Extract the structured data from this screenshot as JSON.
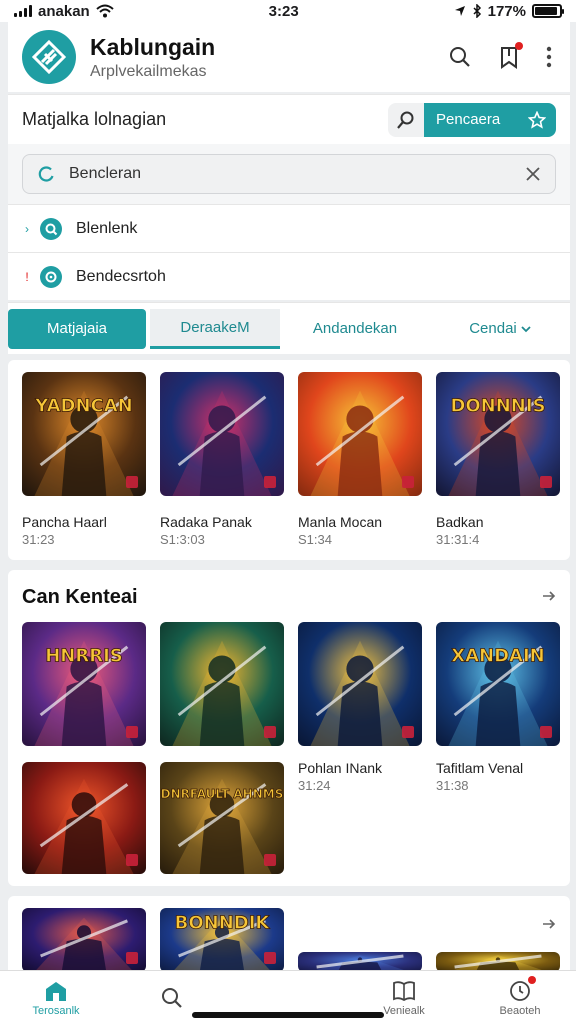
{
  "status": {
    "carrier": "anakan",
    "time": "3:23",
    "battery": "177%",
    "battery_level": 0.92
  },
  "header": {
    "title": "Kablungain",
    "subtitle": "Arplvekailmekas"
  },
  "search_row": {
    "heading": "Matjalka lolnagian",
    "button_label": "Pencaera"
  },
  "filter": {
    "value": "Bencleran"
  },
  "suggestions": [
    {
      "label": "Blenlenk",
      "marker": "›",
      "marker_color": "#1f9ea3"
    },
    {
      "label": "Bendecsrtoh",
      "marker": "!",
      "marker_color": "#e02020"
    }
  ],
  "tabs": [
    "Matjajaia",
    "DeraakeM",
    "Andandekan",
    "Cendai"
  ],
  "featured": {
    "items": [
      {
        "label": "Pancha Haarl",
        "time": "31:23",
        "art": "YADNCAN",
        "colors": [
          "#5a3312",
          "#e08a2a",
          "#22170d"
        ]
      },
      {
        "label": "Radaka Panak",
        "time": "S1:3:03",
        "art": "",
        "colors": [
          "#1b2d72",
          "#d03068",
          "#2f1a4c"
        ]
      },
      {
        "label": "Manla Mocan",
        "time": "S1:34",
        "art": "",
        "colors": [
          "#e0461c",
          "#f7c337",
          "#8a2c10"
        ]
      },
      {
        "label": "Badkan",
        "time": "31:31:4",
        "art": "DONNNIS",
        "colors": [
          "#2a3c86",
          "#e04820",
          "#151838"
        ]
      }
    ]
  },
  "section": {
    "title": "Can Kenteai",
    "items": [
      {
        "label": "",
        "time": "",
        "art": "HNRRIS",
        "colors": [
          "#5b2a86",
          "#ef5a7a",
          "#2b1442"
        ]
      },
      {
        "label": "",
        "time": "",
        "art": "",
        "colors": [
          "#165e4a",
          "#f2b630",
          "#0f2a22"
        ]
      },
      {
        "label": "Pohlan INank",
        "time": "31:24",
        "art": "",
        "colors": [
          "#0f2f6a",
          "#f3c240",
          "#0a1838"
        ]
      },
      {
        "label": "Tafitlam Venal",
        "time": "31:38",
        "art": "XANDAIN",
        "colors": [
          "#143c7a",
          "#5fc3e8",
          "#0b1b3e"
        ]
      },
      {
        "label": "",
        "time": "",
        "art": "",
        "colors": [
          "#8a1a14",
          "#f0562a",
          "#2c0c0a"
        ]
      },
      {
        "label": "",
        "time": "",
        "art": "DNRFAULT AHNMS",
        "colors": [
          "#5a4418",
          "#e0a63a",
          "#2a1e0c"
        ]
      }
    ]
  },
  "third": {
    "items": [
      {
        "art": "",
        "colors": [
          "#2d1c70",
          "#e25a4a",
          "#140c33"
        ]
      },
      {
        "art": "BONNDIK",
        "colors": [
          "#1c3a8a",
          "#f5c23a",
          "#0e1d45"
        ]
      },
      {
        "art": "",
        "colors": [
          "#2a2f7a",
          "#4a78d8",
          "#151744"
        ]
      },
      {
        "art": "",
        "colors": [
          "#7a5a10",
          "#f4d040",
          "#3a2a08"
        ]
      }
    ]
  },
  "nav": [
    "Terosanlk",
    "",
    "Veniealk",
    "Beaoteh"
  ],
  "colors": {
    "accent": "#1f9ea3",
    "badge": "#e02020"
  }
}
